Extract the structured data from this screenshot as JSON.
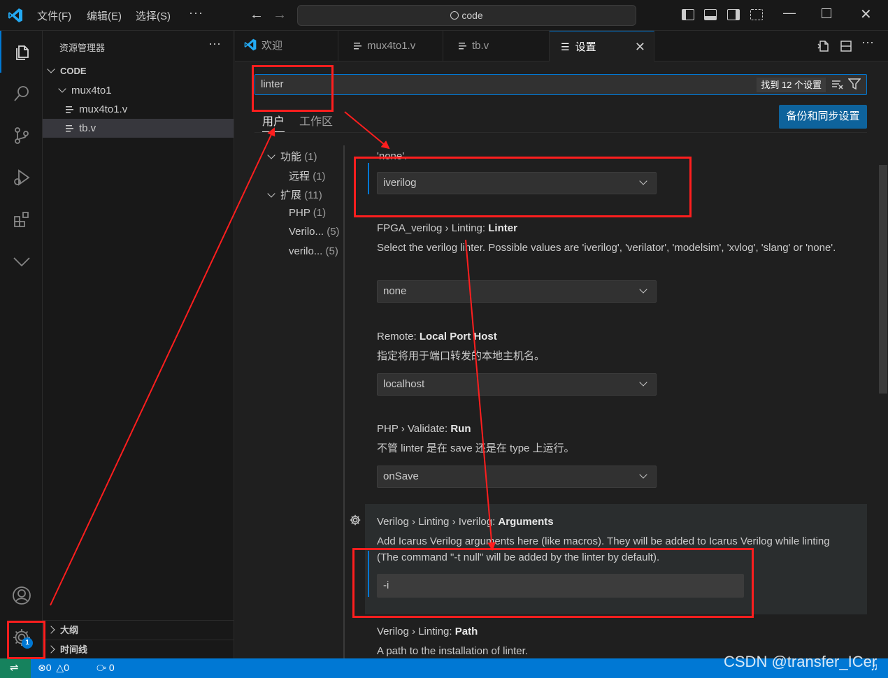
{
  "titlebar": {
    "menus": [
      "文件(F)",
      "编辑(E)",
      "选择(S)"
    ],
    "more": "···",
    "command_center": "code"
  },
  "sidebar": {
    "title": "资源管理器",
    "more": "···",
    "workspace": "CODE",
    "folder": "mux4to1",
    "files": [
      "mux4to1.v",
      "tb.v"
    ],
    "panels": [
      "大纲",
      "时间线"
    ]
  },
  "activitybar": {
    "icons": [
      "files-icon",
      "search-icon",
      "source-control-icon",
      "run-debug-icon",
      "extensions-icon",
      "more-icon",
      "account-icon",
      "manage-gear-icon"
    ],
    "manage_badge": "1"
  },
  "tabs": [
    {
      "label": "欢迎",
      "icon": "vscode-logo-icon"
    },
    {
      "label": "mux4to1.v",
      "icon": "file-icon"
    },
    {
      "label": "tb.v",
      "icon": "file-icon"
    },
    {
      "label": "设置",
      "icon": "settings-icon",
      "active": true
    }
  ],
  "settings": {
    "search_value": "linter",
    "found_text": "找到 12 个设置",
    "sync_button": "备份和同步设置",
    "scope_tabs": [
      "用户",
      "工作区"
    ],
    "toc": [
      {
        "label": "功能",
        "count": "(1)",
        "expanded": true
      },
      {
        "label": "远程",
        "count": "(1)"
      },
      {
        "label": "扩展",
        "count": "(11)",
        "expanded": true
      },
      {
        "label": "PHP",
        "count": "(1)"
      },
      {
        "label": "Verilo...",
        "count": "(5)"
      },
      {
        "label": "verilo...",
        "count": "(5)"
      }
    ],
    "clipped_text": "'none'.",
    "first_dropdown": "iverilog",
    "items": [
      {
        "prefix": "FPGA_verilog › Linting: ",
        "name": "Linter",
        "description": "Select the verilog linter. Possible values are 'iverilog', 'verilator', 'modelsim', 'xvlog', 'slang' or 'none'.",
        "value": "none"
      },
      {
        "prefix": "Remote: ",
        "name": "Local Port Host",
        "description": "指定将用于端口转发的本地主机名。",
        "value": "localhost"
      },
      {
        "prefix": "PHP › Validate: ",
        "name": "Run",
        "description": "不管 linter 是在 save 还是在 type 上运行。",
        "value": "onSave"
      },
      {
        "prefix": "Verilog › Linting › Iverilog: ",
        "name": "Arguments",
        "description": "Add Icarus Verilog arguments here (like macros). They will be added to Icarus Verilog while linting (The command \"-t null\" will be added by the linter by default).",
        "value": "-i"
      },
      {
        "prefix": "Verilog › Linting: ",
        "name": "Path",
        "description": "A path to the installation of linter."
      }
    ]
  },
  "statusbar": {
    "errors": "0",
    "warnings": "0",
    "ports": "0"
  },
  "watermark": "CSDN @transfer_ICer",
  "colors": {
    "accent": "#0078d4",
    "annotation": "#ff1e1e",
    "sync_button": "#0e639c",
    "remote": "#16825d"
  }
}
